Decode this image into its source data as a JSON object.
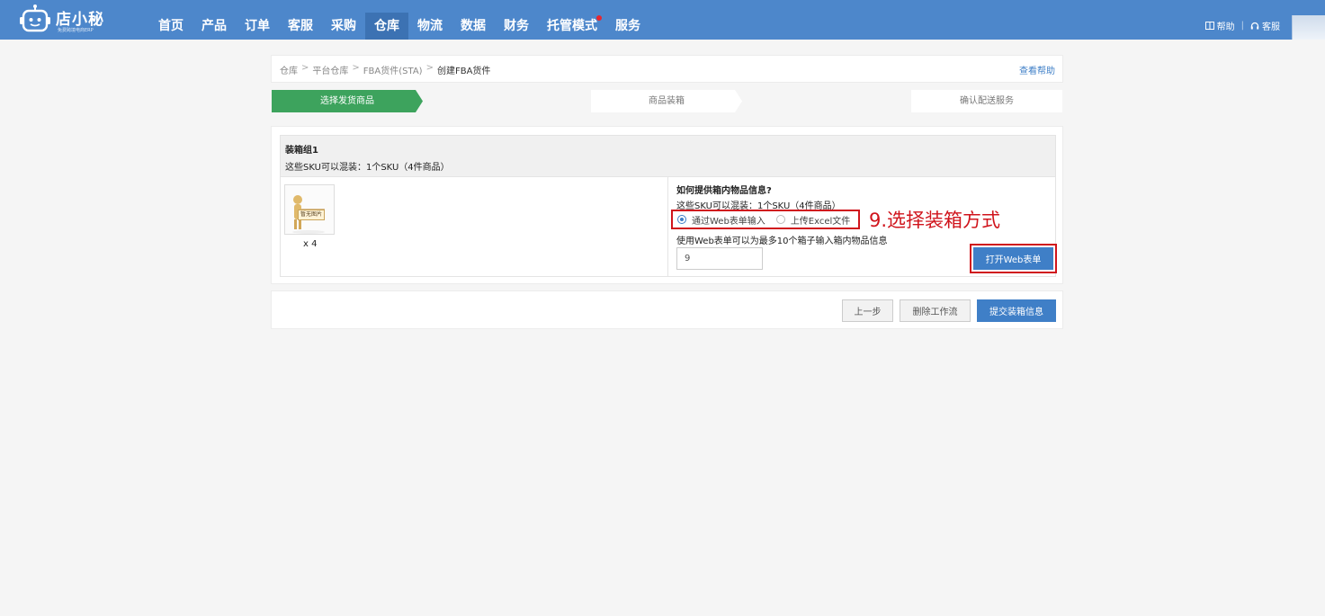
{
  "header": {
    "brand_name": "店小秘",
    "brand_sub": "免费跨境电商ERP",
    "nav": [
      {
        "label": "首页"
      },
      {
        "label": "产品"
      },
      {
        "label": "订单"
      },
      {
        "label": "客服"
      },
      {
        "label": "采购"
      },
      {
        "label": "仓库",
        "active": true
      },
      {
        "label": "物流"
      },
      {
        "label": "数据"
      },
      {
        "label": "财务"
      },
      {
        "label": "托管模式",
        "badge": true
      },
      {
        "label": "服务"
      }
    ],
    "help_label": "帮助",
    "service_label": "客服"
  },
  "breadcrumb": {
    "items": [
      "仓库",
      "平台仓库",
      "FBA货件(STA)",
      "创建FBA货件"
    ],
    "help_link": "查看帮助"
  },
  "steps": [
    {
      "label": "选择发货商品",
      "active": true
    },
    {
      "label": "商品装箱",
      "active": false
    },
    {
      "label": "确认配送服务",
      "active": false
    }
  ],
  "pack_group": {
    "title": "装箱组1",
    "desc": "这些SKU可以混装：1个SKU（4件商品）",
    "thumb_label": "暂无图片",
    "qty": "x 4",
    "question": "如何提供箱内物品信息?",
    "question_desc": "这些SKU可以混装：1个SKU（4件商品）",
    "options": [
      {
        "label": "通过Web表单输入",
        "checked": true
      },
      {
        "label": "上传Excel文件",
        "checked": false
      }
    ],
    "annotation": "9.选择装箱方式",
    "hint": "使用Web表单可以为最多10个箱子输入箱内物品信息",
    "box_count_value": "9",
    "open_form_button": "打开Web表单"
  },
  "actions": {
    "prev": "上一步",
    "delete": "删除工作流",
    "submit": "提交装箱信息"
  },
  "colors": {
    "header_bg": "#4d87cb",
    "nav_active_bg": "#3c72b3",
    "step_active": "#3da35d",
    "primary": "#3f7fc7",
    "highlight_red": "#d0141c"
  }
}
